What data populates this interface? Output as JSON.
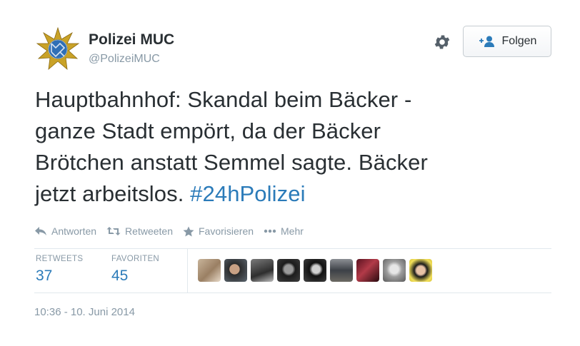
{
  "user": {
    "name": "Polizei MUC",
    "handle": "@PolizeiMUC",
    "avatar_icon": "police-star-badge-icon"
  },
  "header": {
    "settings_icon": "gear-icon",
    "follow_label": "Folgen",
    "follow_icon": "add-user-icon"
  },
  "tweet": {
    "text_line1": "Hauptbahnhof: Skandal beim Bäcker -",
    "text_line2": "ganze Stadt empört, da der Bäcker",
    "text_line3": "Brötchen anstatt Semmel sagte. Bäcker",
    "text_line4": "jetzt arbeitslos.",
    "hashtag": "#24hPolizei"
  },
  "actions": {
    "reply": "Antworten",
    "retweet": "Retweeten",
    "favorite": "Favorisieren",
    "more": "Mehr"
  },
  "stats": {
    "retweets_label": "RETWEETS",
    "retweets_count": "37",
    "favorites_label": "FAVORITEN",
    "favorites_count": "45"
  },
  "timestamp": "10:36 - 10. Juni 2014",
  "colors": {
    "link": "#2b7bb9",
    "muted": "#8899a6",
    "text": "#292f33",
    "border": "#e1e8ed"
  }
}
